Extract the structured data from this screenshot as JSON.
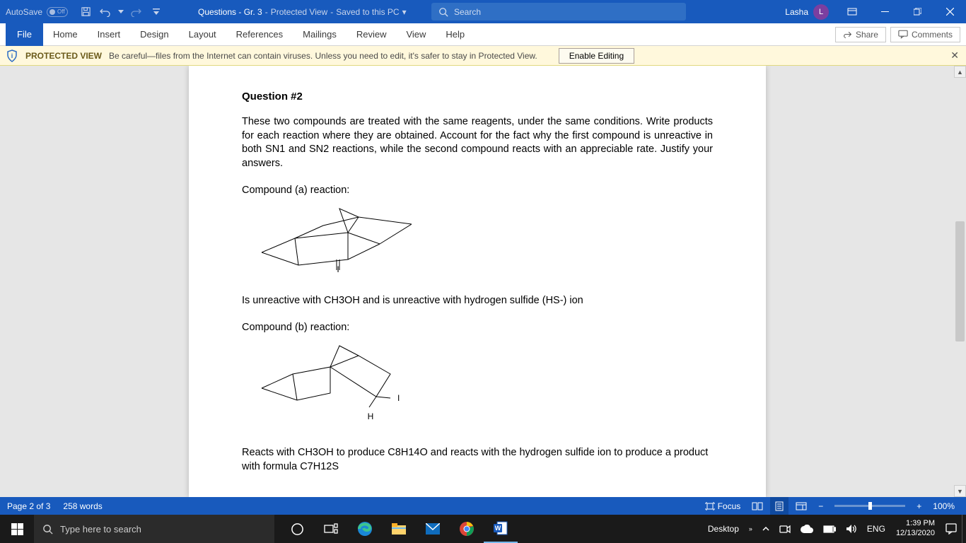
{
  "titlebar": {
    "autosave_label": "AutoSave",
    "autosave_state": "Off",
    "doc_title": "Questions - Gr. 3",
    "protected": "Protected View",
    "saved": "Saved to this PC",
    "search_placeholder": "Search",
    "user_name": "Lasha",
    "user_initial": "L"
  },
  "ribbon": {
    "tabs": [
      "File",
      "Home",
      "Insert",
      "Design",
      "Layout",
      "References",
      "Mailings",
      "Review",
      "View",
      "Help"
    ],
    "share": "Share",
    "comments": "Comments"
  },
  "protected_view": {
    "title": "PROTECTED VIEW",
    "msg": "Be careful—files from the Internet can contain viruses. Unless you need to edit, it's safer to stay in Protected View.",
    "enable": "Enable Editing"
  },
  "document": {
    "q_title": "Question #2",
    "intro": "These two compounds are treated with the same reagents, under the same conditions. Write products for each reaction where they are obtained. Account for the fact why the first compound is unreactive in both SN1 and SN2 reactions, while the second compound reacts with an appreciable rate. Justify your answers.",
    "comp_a_label": "Compound (a) reaction:",
    "comp_a_result": "Is unreactive with CH3OH and is unreactive with hydrogen sulfide (HS-) ion",
    "comp_b_label": "Compound (b) reaction:",
    "comp_b_result": "Reacts with CH3OH to produce C8H14O and reacts with the hydrogen sulfide ion to produce a product with formula C7H12S",
    "label_I": "I",
    "label_H": "H"
  },
  "statusbar": {
    "page": "Page 2 of 3",
    "words": "258 words",
    "focus": "Focus",
    "zoom": "100%"
  },
  "taskbar": {
    "search": "Type here to search",
    "desktop": "Desktop",
    "lang": "ENG",
    "time": "1:39 PM",
    "date": "12/13/2020"
  }
}
